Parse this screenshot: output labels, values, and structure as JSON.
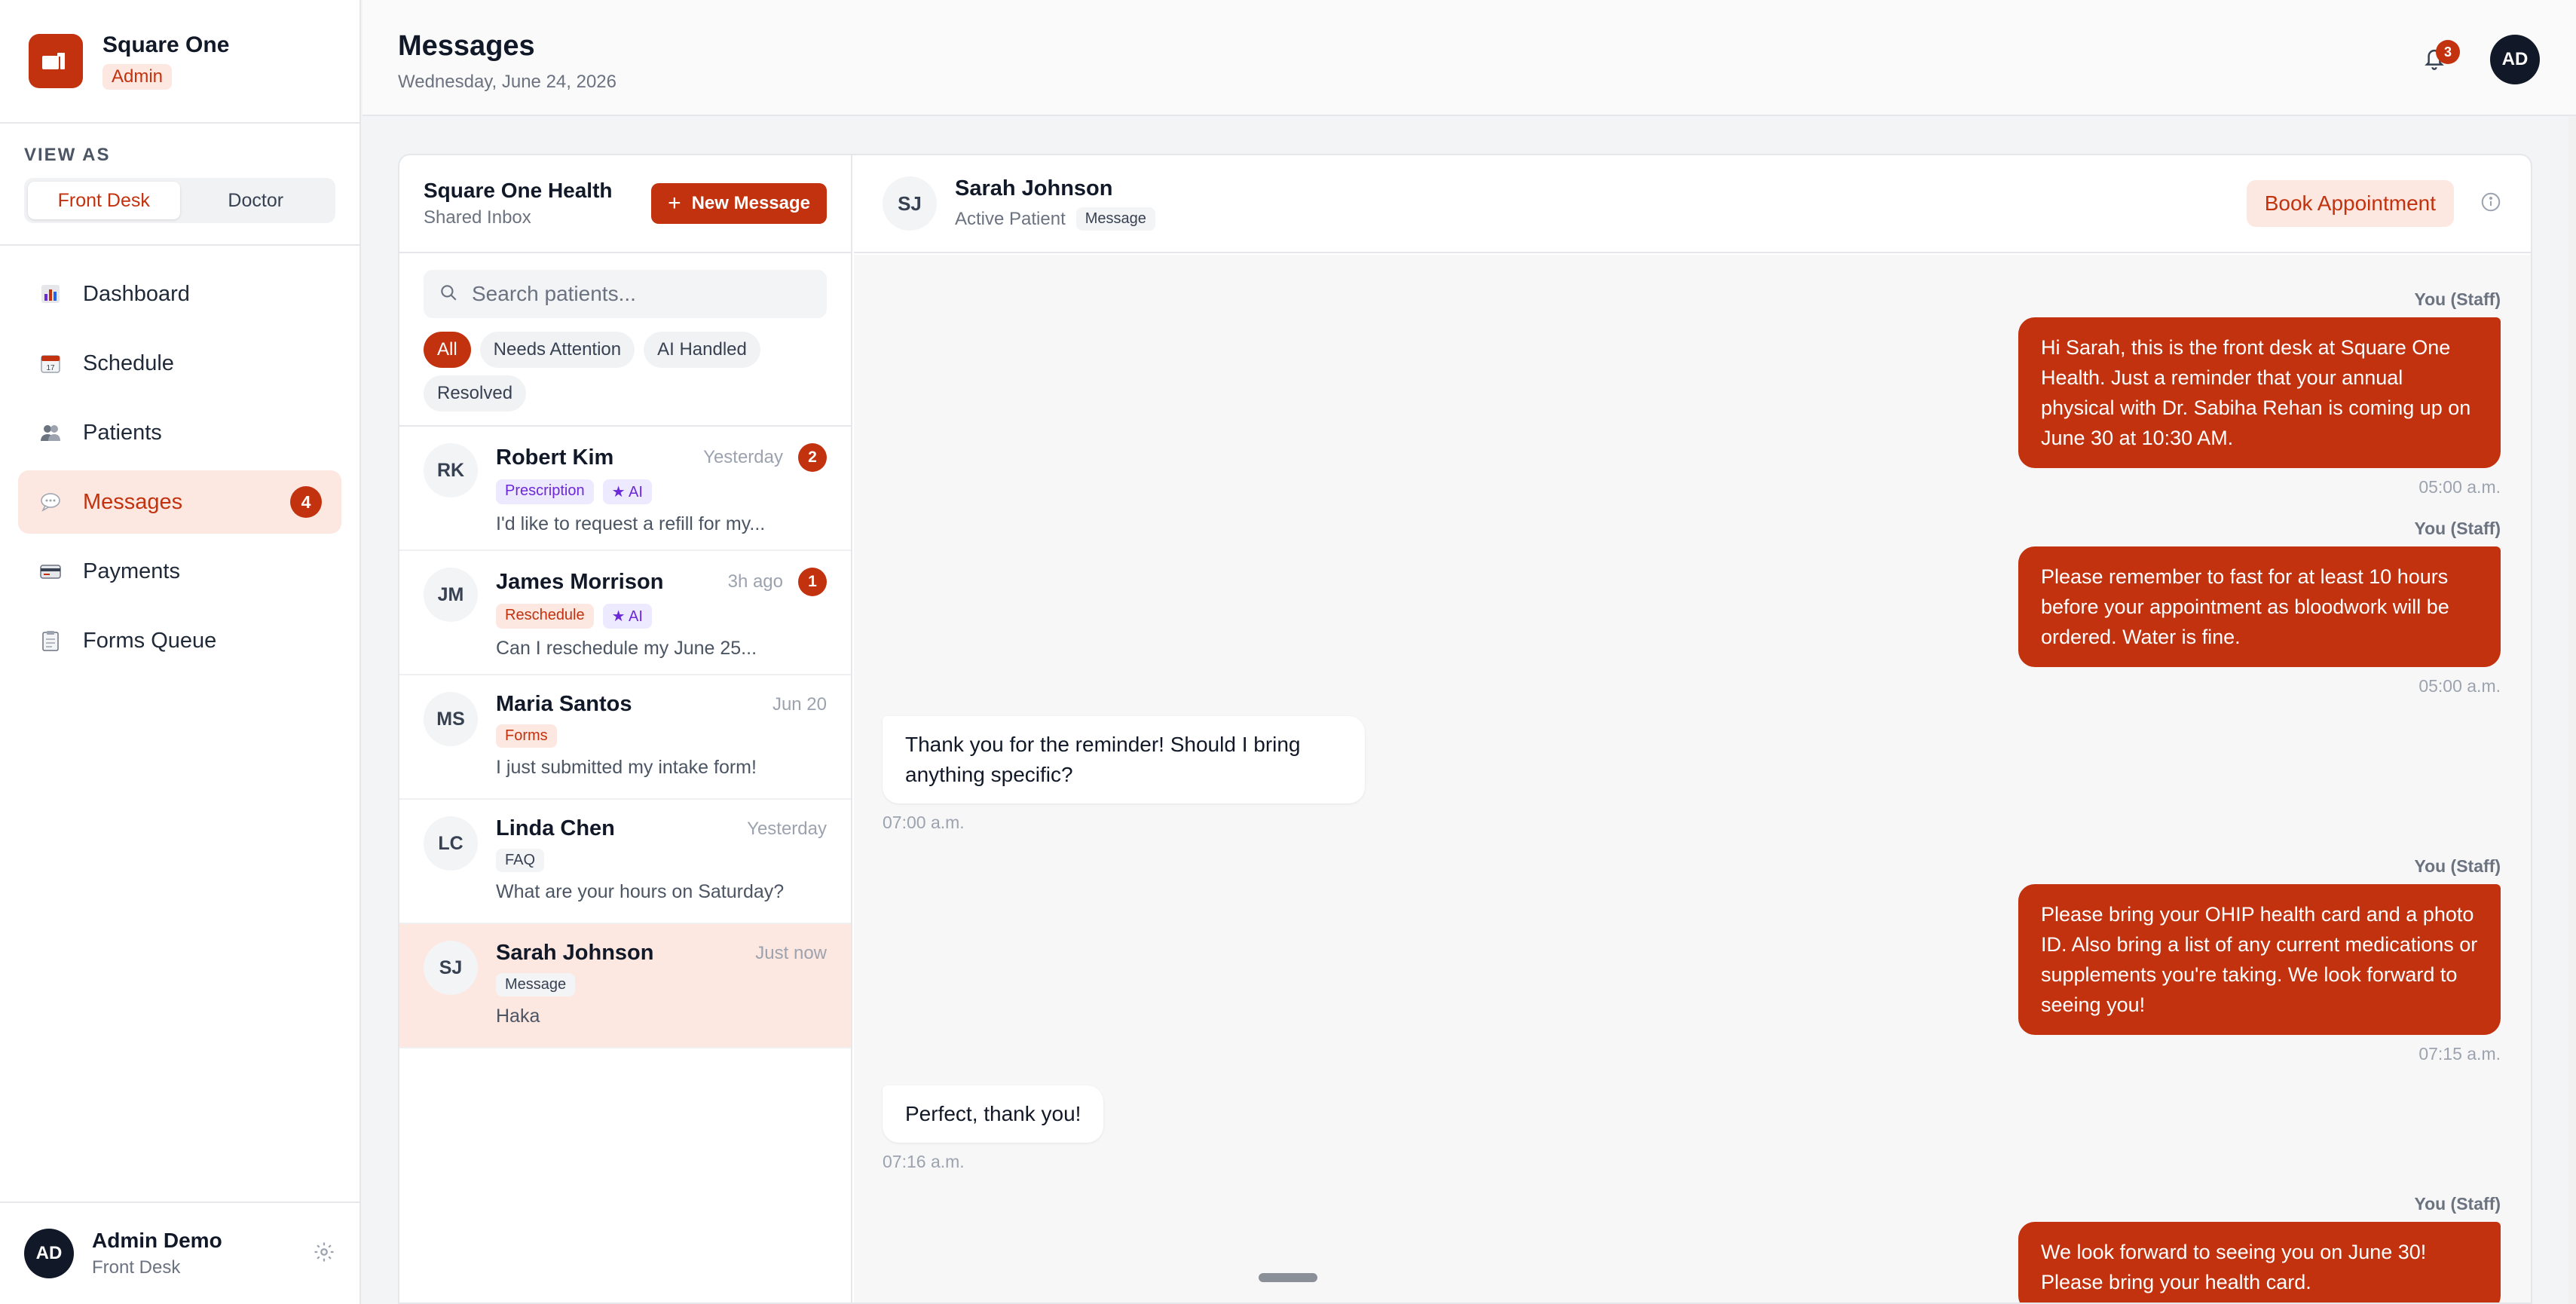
{
  "brand": {
    "name": "Square One",
    "role": "Admin"
  },
  "view_as": {
    "label": "VIEW AS",
    "options": [
      "Front Desk",
      "Doctor"
    ]
  },
  "nav": [
    {
      "label": "Dashboard",
      "icon": "chart-icon"
    },
    {
      "label": "Schedule",
      "icon": "calendar-icon"
    },
    {
      "label": "Patients",
      "icon": "users-icon"
    },
    {
      "label": "Messages",
      "icon": "speech-bubble-icon",
      "badge": "4"
    },
    {
      "label": "Payments",
      "icon": "credit-card-icon"
    },
    {
      "label": "Forms Queue",
      "icon": "clipboard-icon"
    }
  ],
  "user": {
    "initials": "AD",
    "name": "Admin Demo",
    "role": "Front Desk"
  },
  "header": {
    "title": "Messages",
    "date": "Wednesday, June 24, 2026",
    "notifications": "3",
    "avatar": "AD"
  },
  "inbox": {
    "title": "Square One Health",
    "subtitle": "Shared Inbox",
    "new_button": "New Message",
    "search_placeholder": "Search patients...",
    "filters": [
      "All",
      "Needs Attention",
      "AI Handled",
      "Resolved"
    ],
    "conversations": [
      {
        "initials": "RK",
        "name": "Robert Kim",
        "time": "Yesterday",
        "unread": "2",
        "tag": "Prescription",
        "ai": "★ AI",
        "preview": "I'd like to request a refill for my..."
      },
      {
        "initials": "JM",
        "name": "James Morrison",
        "time": "3h ago",
        "unread": "1",
        "tag": "Reschedule",
        "ai": "★ AI",
        "preview": "Can I reschedule my June 25..."
      },
      {
        "initials": "MS",
        "name": "Maria Santos",
        "time": "Jun 20",
        "tag": "Forms",
        "preview": "I just submitted my intake form!"
      },
      {
        "initials": "LC",
        "name": "Linda Chen",
        "time": "Yesterday",
        "tag": "FAQ",
        "preview": "What are your hours on Saturday?"
      },
      {
        "initials": "SJ",
        "name": "Sarah Johnson",
        "time": "Just now",
        "tag": "Message",
        "preview": "Haka"
      }
    ]
  },
  "chat": {
    "initials": "SJ",
    "name": "Sarah Johnson",
    "status": "Active Patient",
    "tag": "Message",
    "book_button": "Book Appointment",
    "messages": [
      {
        "from": "staff",
        "sender": "You (Staff)",
        "text": "Hi Sarah, this is the front desk at Square One Health. Just a reminder that your annual physical with Dr. Sabiha Rehan is coming up on June 30 at 10:30 AM.",
        "time": "05:00 a.m."
      },
      {
        "from": "staff",
        "sender": "You (Staff)",
        "text": "Please remember to fast for at least 10 hours before your appointment as bloodwork will be ordered. Water is fine.",
        "time": "05:00 a.m."
      },
      {
        "from": "patient",
        "text": "Thank you for the reminder! Should I bring anything specific?",
        "time": "07:00 a.m."
      },
      {
        "from": "staff",
        "sender": "You (Staff)",
        "text": "Please bring your OHIP health card and a photo ID. Also bring a list of any current medications or supplements you're taking. We look forward to seeing you!",
        "time": "07:15 a.m."
      },
      {
        "from": "patient",
        "text": "Perfect, thank you!",
        "time": "07:16 a.m."
      },
      {
        "from": "staff",
        "sender": "You (Staff)",
        "text": "We look forward to seeing you on June 30! Please bring your health card.",
        "time": ""
      }
    ]
  },
  "colors": {
    "accent": "#c2320e",
    "accent_soft": "#fde7e1",
    "ai_purple": "#6d28d9"
  }
}
